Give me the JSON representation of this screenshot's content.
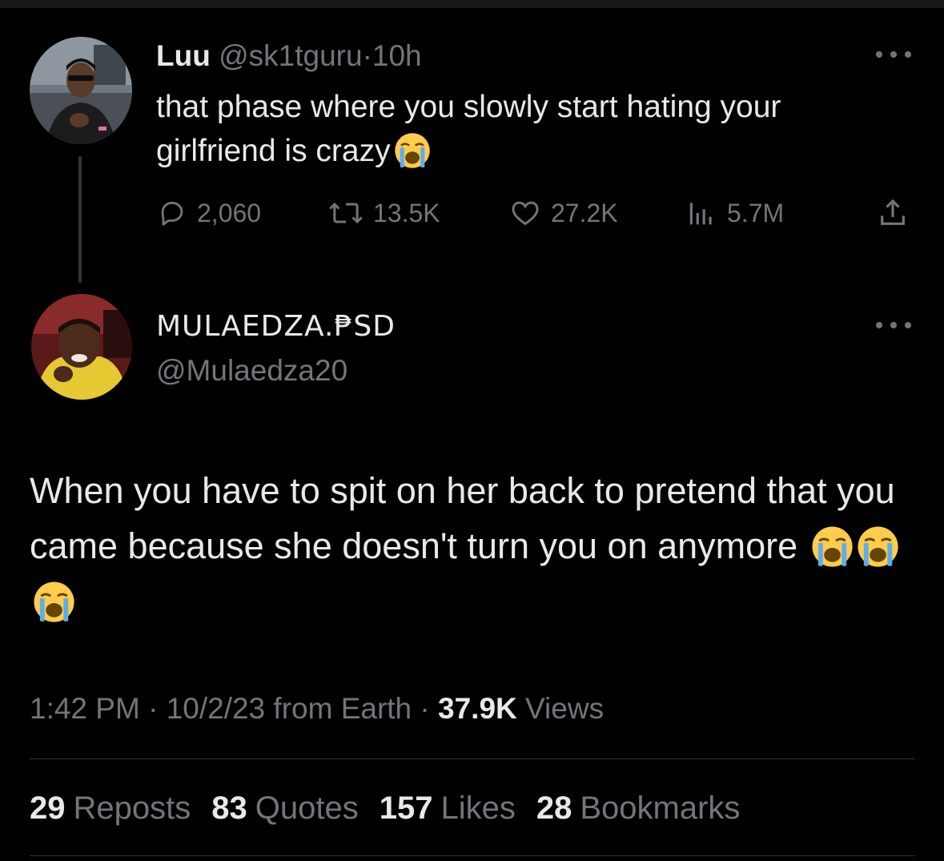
{
  "parent_tweet": {
    "display_name": "Luu",
    "handle": "@sk1tguru",
    "separator": "·",
    "time": "10h",
    "text": "that phase where you slowly start hating your girlfriend is crazy",
    "text_emoji": "loudly-crying-face-emoji",
    "actions": {
      "replies": "2,060",
      "reposts": "13.5K",
      "likes": "27.2K",
      "views": "5.7M"
    },
    "icons": [
      "reply-icon",
      "repost-icon",
      "like-icon",
      "views-icon",
      "share-icon",
      "more-icon"
    ]
  },
  "main_tweet": {
    "display_name": "MULAEDZA.₱SD",
    "handle": "@Mulaedza20",
    "text": "When you have to spit on her back to pretend that you came because she doesn't turn you on anymore",
    "text_emojis": [
      "loudly-crying-face-emoji",
      "loudly-crying-face-emoji",
      "loudly-crying-face-emoji"
    ],
    "time": "1:42 PM",
    "separator": "·",
    "date_location": "10/2/23 from Earth",
    "views_count": "37.9K",
    "views_label": "Views",
    "stats": [
      {
        "count": "29",
        "label": "Reposts"
      },
      {
        "count": "83",
        "label": "Quotes"
      },
      {
        "count": "157",
        "label": "Likes"
      },
      {
        "count": "28",
        "label": "Bookmarks"
      }
    ]
  },
  "colors": {
    "background": "#000000",
    "text_primary": "#e7e9ea",
    "text_muted": "#71767b",
    "divider": "#2f3336",
    "thread_line": "#333639",
    "emoji_yellow": "#ffcc4d",
    "emoji_tear": "#5dadec"
  }
}
